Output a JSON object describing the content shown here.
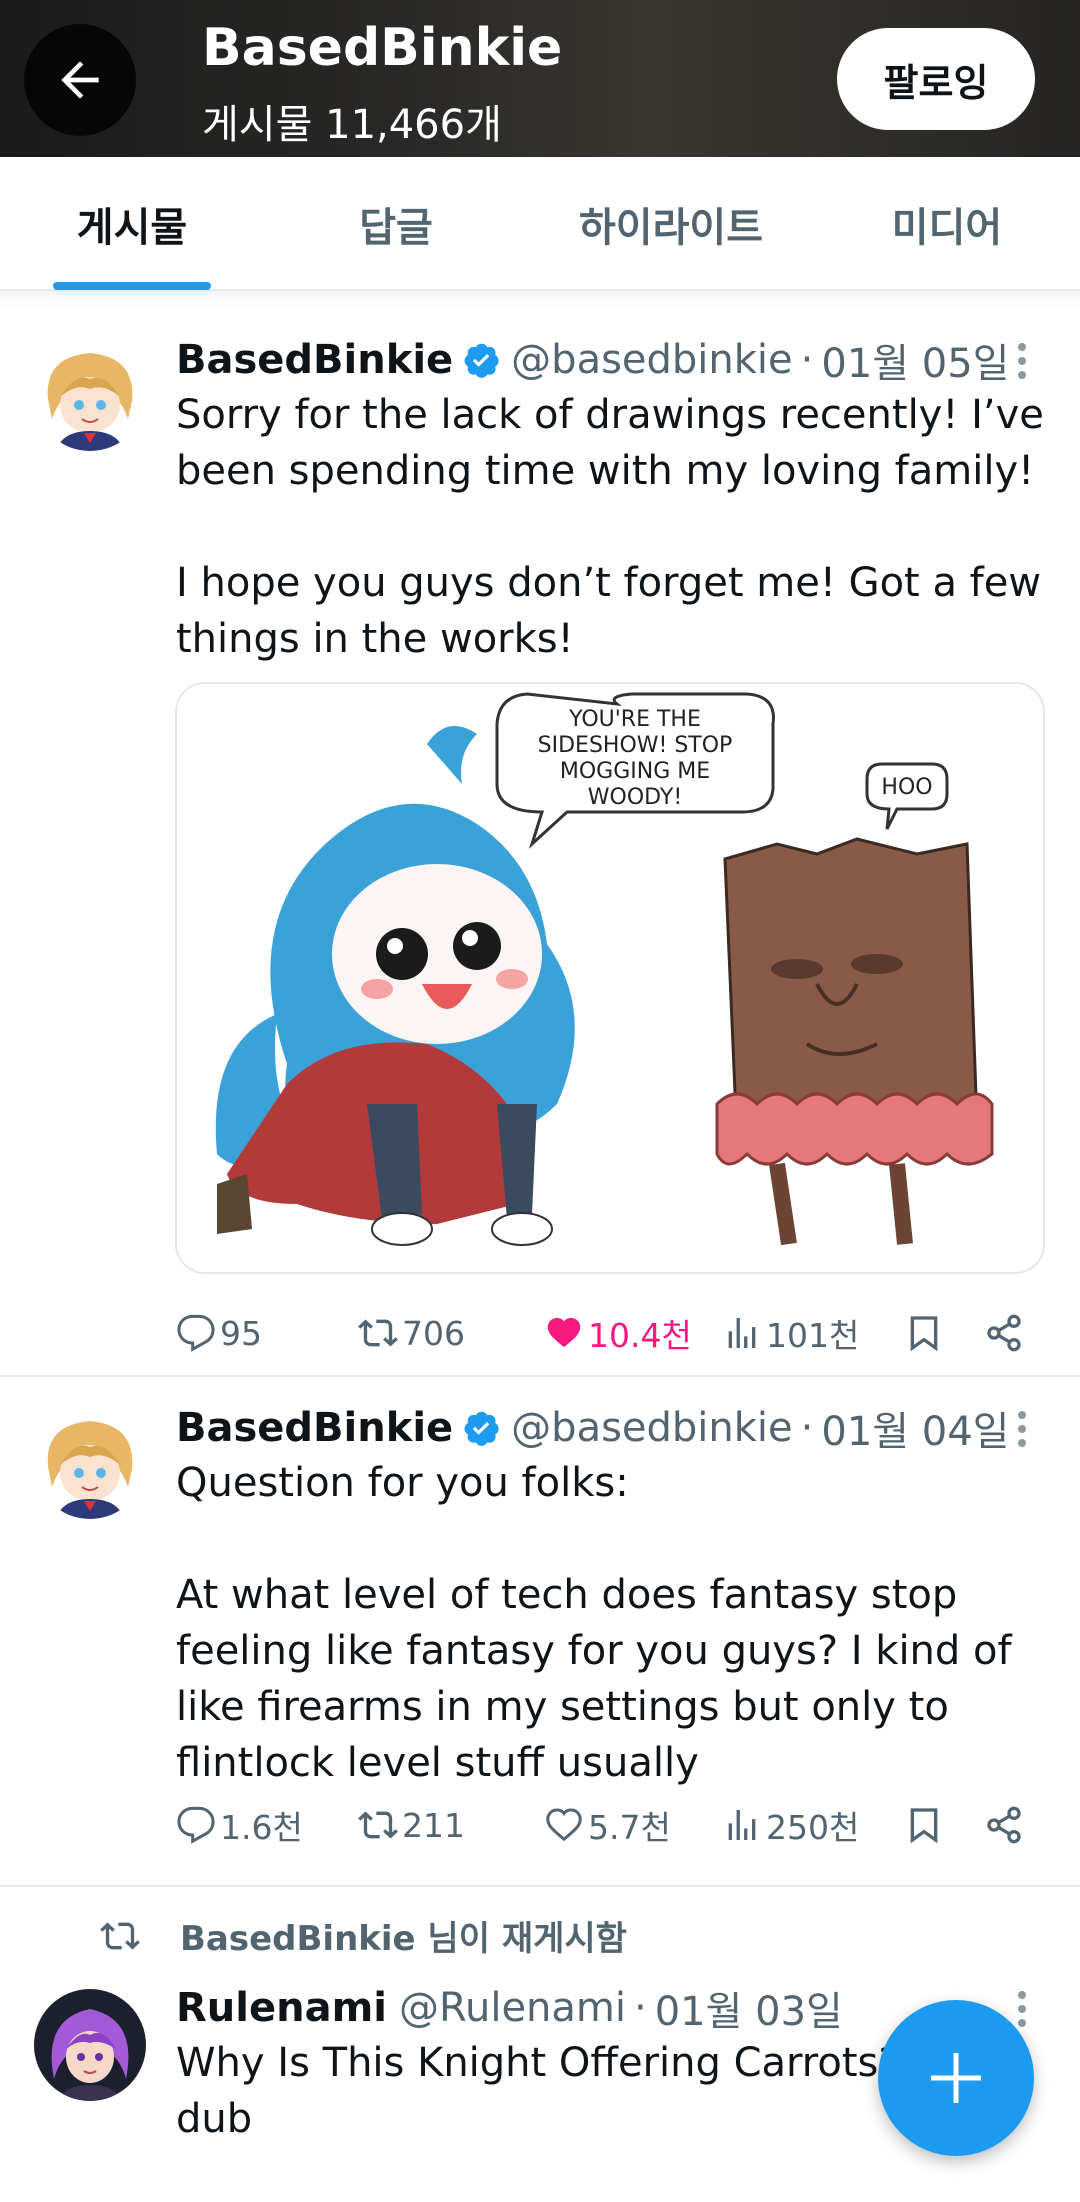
{
  "header": {
    "title": "BasedBinkie",
    "post_count": "게시물 11,466개",
    "follow_label": "팔로잉"
  },
  "tabs": [
    {
      "label": "게시물",
      "active": true
    },
    {
      "label": "답글",
      "active": false
    },
    {
      "label": "하이라이트",
      "active": false
    },
    {
      "label": "미디어",
      "active": false
    }
  ],
  "posts": [
    {
      "name": "BasedBinkie",
      "handle": "@basedbinkie",
      "dot": "·",
      "date": "01월 05일",
      "text": "Sorry for the lack of drawings recently! I’ve been spending time with my loving family!\n\nI hope you guys don’t forget me! Got a few things in the works!",
      "image": {
        "bubble_main": [
          "YOU'RE THE",
          "SIDESHOW! STOP",
          "MOGGING ME",
          "WOODY!"
        ],
        "bubble_small": "HOO"
      },
      "stats": {
        "replies": "95",
        "reposts": "706",
        "likes": "10.4천",
        "views": "101천"
      }
    },
    {
      "name": "BasedBinkie",
      "handle": "@basedbinkie",
      "dot": "·",
      "date": "01월 04일",
      "text": "Question for you folks:\n\nAt what level of tech does fantasy stop feeling like fantasy for you guys? I kind of like firearms in my settings but only to flintlock level stuff usually",
      "stats": {
        "replies": "1.6천",
        "reposts": "211",
        "likes": "5.7천",
        "views": "250천"
      }
    },
    {
      "repost_label": "BasedBinkie 님이 재게시함",
      "name": "Rulenami",
      "handle": "@Rulenami",
      "dot": "·",
      "date": "01월 03일",
      "text": "Why Is This Knight Offering Carrots?! dub"
    }
  ],
  "colors": {
    "accent": "#1d9bf0",
    "like": "#f91880",
    "secondary_text": "#536471"
  }
}
